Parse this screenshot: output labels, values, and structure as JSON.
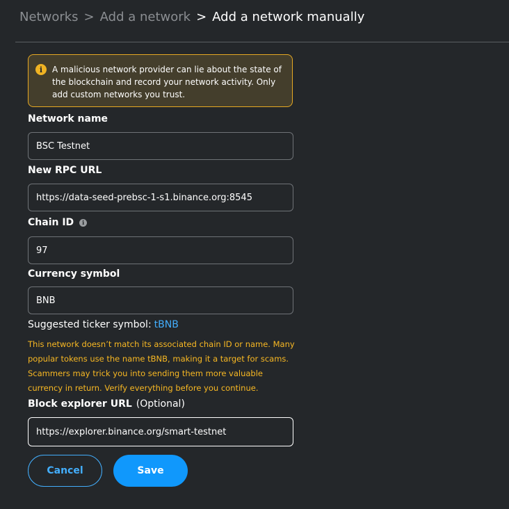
{
  "breadcrumb": {
    "networks": "Networks",
    "add_network": "Add a network",
    "current": "Add a network manually",
    "separator": ">"
  },
  "warning": {
    "icon": "info-icon",
    "text": "A malicious network provider can lie about the state of the blockchain and record your network activity. Only add custom networks you trust."
  },
  "form": {
    "network_name": {
      "label": "Network name",
      "value": "BSC Testnet"
    },
    "rpc_url": {
      "label": "New RPC URL",
      "value": "https://data-seed-prebsc-1-s1.binance.org:8545"
    },
    "chain_id": {
      "label": "Chain ID",
      "value": "97",
      "info_icon": "i"
    },
    "currency_symbol": {
      "label": "Currency symbol",
      "value": "BNB"
    },
    "suggested_ticker": {
      "label": "Suggested ticker symbol:",
      "value": "tBNB"
    },
    "ticker_warning": "This network doesn’t match its associated chain ID or name. Many popular tokens use the name tBNB, making it a target for scams. Scammers may trick you into sending them more valuable currency in return. Verify everything before you continue.",
    "block_explorer": {
      "label": "Block explorer URL",
      "optional": "(Optional)",
      "value": "https://explorer.binance.org/smart-testnet"
    }
  },
  "actions": {
    "cancel": "Cancel",
    "save": "Save"
  },
  "colors": {
    "background": "#24272a",
    "accent": "#1098fc",
    "link": "#43aefc",
    "warning": "#f8b823"
  }
}
